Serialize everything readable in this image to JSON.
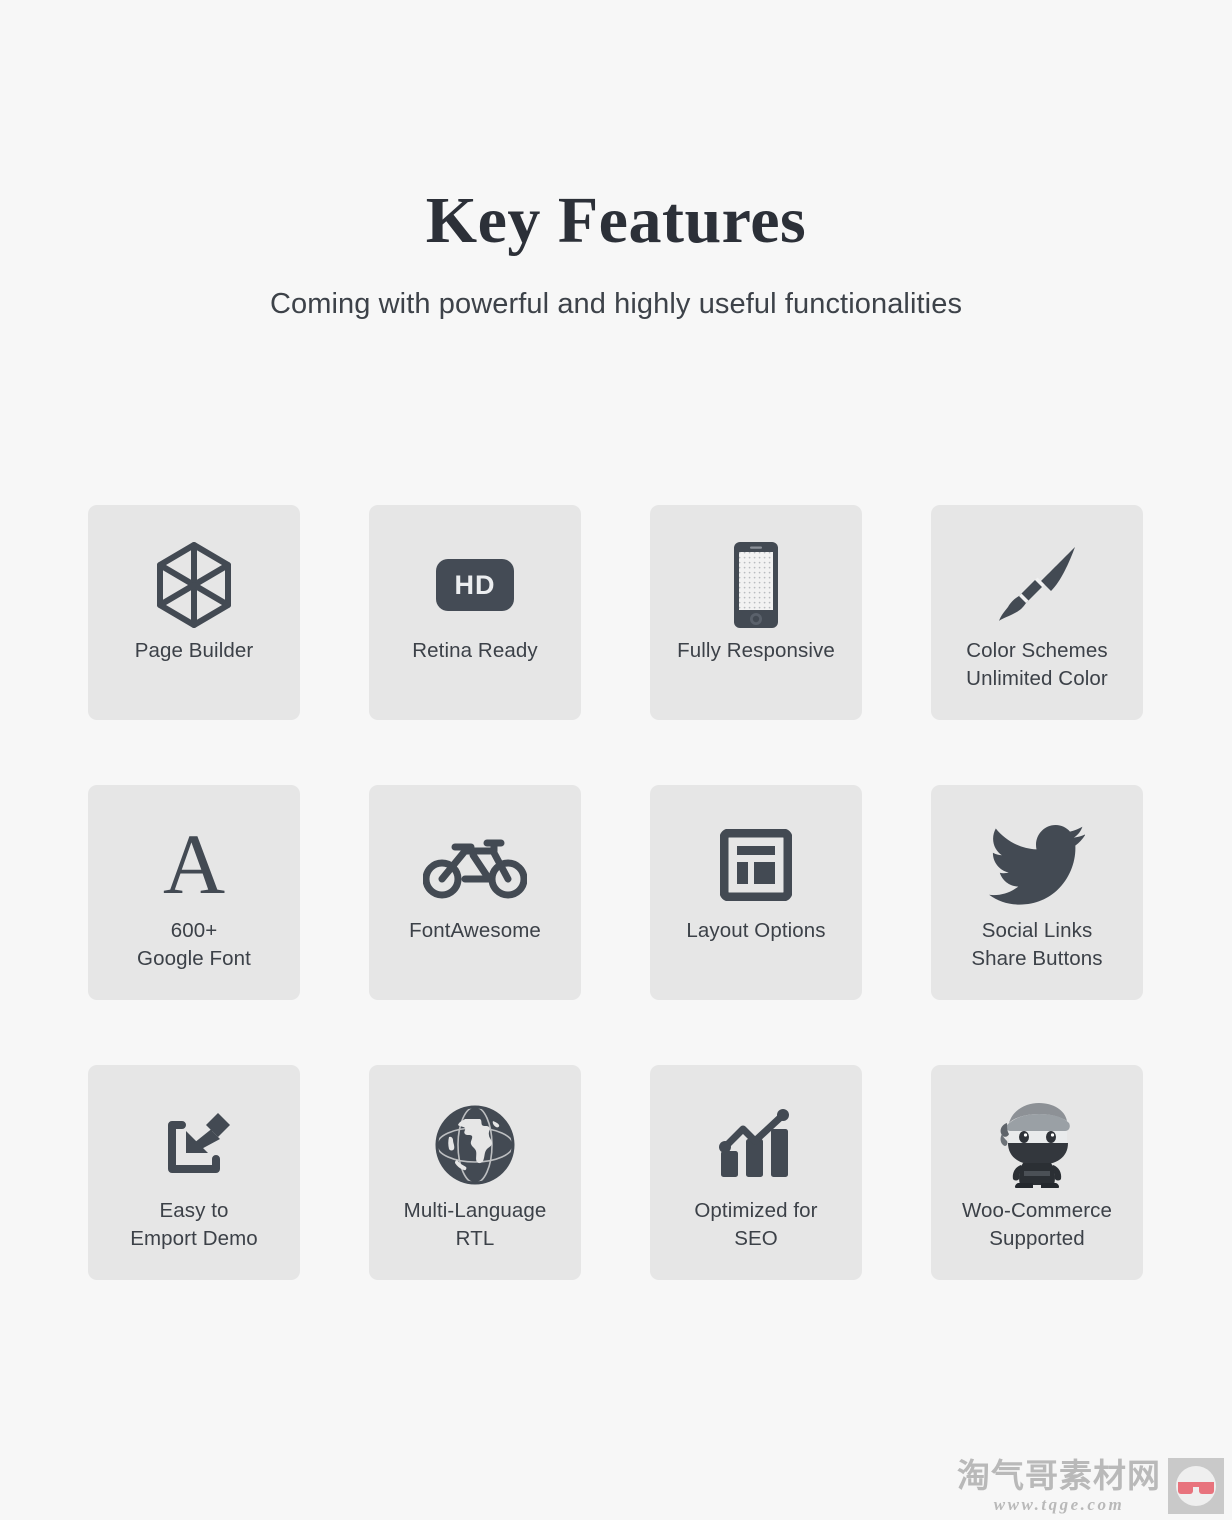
{
  "header": {
    "title": "Key Features",
    "subtitle": "Coming with powerful and highly useful functionalities"
  },
  "colors": {
    "page_background": "#f7f7f7",
    "card_background": "#e6e6e6",
    "icon": "#434a53",
    "title_text": "#2c3038",
    "label_text": "#3c4148",
    "badge_background": "#444b55",
    "watermark": "#b9b9b9",
    "watermark_accent": "#e8737d"
  },
  "features": [
    {
      "icon": "cube-icon",
      "line1": "Page Builder",
      "line2": ""
    },
    {
      "icon": "hd-badge-icon",
      "line1": "Retina Ready",
      "line2": "",
      "badge_text": "HD"
    },
    {
      "icon": "smartphone-icon",
      "line1": "Fully Responsive",
      "line2": ""
    },
    {
      "icon": "paintbrush-icon",
      "line1": "Color Schemes",
      "line2": "Unlimited Color"
    },
    {
      "icon": "letter-a-icon",
      "line1": "600+",
      "line2": "Google Font",
      "glyph": "A"
    },
    {
      "icon": "bicycle-icon",
      "line1": "FontAwesome",
      "line2": ""
    },
    {
      "icon": "layout-grid-icon",
      "line1": "Layout Options",
      "line2": ""
    },
    {
      "icon": "twitter-bird-icon",
      "line1": "Social Links",
      "line2": "Share Buttons"
    },
    {
      "icon": "import-arrow-icon",
      "line1": "Easy to",
      "line2": "Emport Demo"
    },
    {
      "icon": "globe-icon",
      "line1": "Multi-Language",
      "line2": "RTL"
    },
    {
      "icon": "bar-chart-growth-icon",
      "line1": "Optimized for",
      "line2": "SEO"
    },
    {
      "icon": "ninja-mascot-icon",
      "line1": "Woo-Commerce",
      "line2": "Supported"
    }
  ],
  "watermark": {
    "name": "淘气哥素材网",
    "url": "www.tqge.com",
    "logo": "glasses-logo"
  }
}
